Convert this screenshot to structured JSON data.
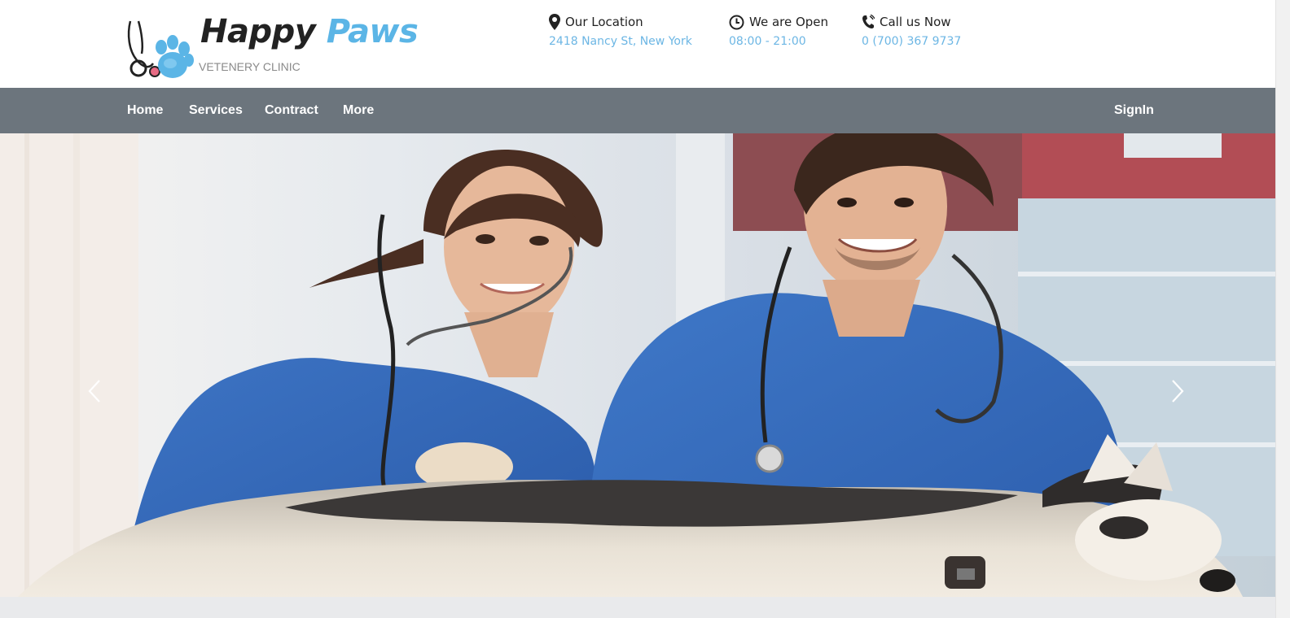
{
  "brand": {
    "title_part1": "Happy",
    "title_part2": "Paws",
    "subtitle": "VETENERY CLINIC",
    "logo_icon": "stethoscope-paw-icon",
    "accent_color": "#5bb5e6"
  },
  "contact": {
    "location": {
      "icon": "map-pin-icon",
      "label": "Our Location",
      "value": "2418 Nancy St, New York"
    },
    "hours": {
      "icon": "clock-icon",
      "label": "We are Open",
      "value": "08:00 - 21:00"
    },
    "phone": {
      "icon": "phone-icon",
      "label": "Call us Now",
      "value": "0 (700) 367 9737"
    }
  },
  "nav": {
    "items": [
      "Home",
      "Services",
      "Contract",
      "More"
    ],
    "signin": "SignIn",
    "background_color": "#6c757d"
  },
  "hero": {
    "image": "Two veterinarians in blue scrubs with stethoscopes examining a husky dog on a table",
    "prev_icon": "chevron-left-icon",
    "next_icon": "chevron-right-icon"
  }
}
